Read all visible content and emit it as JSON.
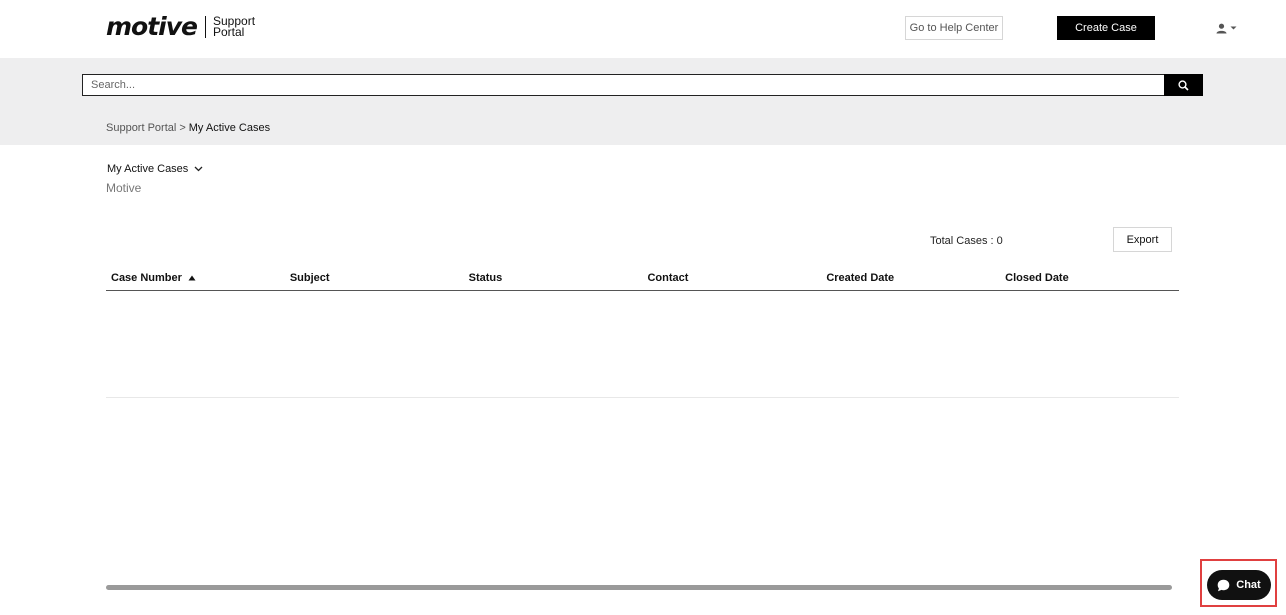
{
  "header": {
    "logo_text": "motive",
    "logo_sub_line1": "Support",
    "logo_sub_line2": "Portal",
    "help_center_label": "Go to Help Center",
    "create_case_label": "Create Case",
    "user_icon": "user-icon"
  },
  "search": {
    "placeholder": "Search...",
    "icon": "search-icon"
  },
  "breadcrumb": {
    "root": "Support Portal",
    "separator": ">",
    "current": "My Active Cases"
  },
  "list": {
    "title": "My Active Cases",
    "subtitle": "Motive",
    "total_label": "Total Cases : 0",
    "export_label": "Export"
  },
  "table": {
    "columns": [
      "Case Number",
      "Subject",
      "Status",
      "Contact",
      "Created Date",
      "Closed Date"
    ],
    "sorted_column": "Case Number",
    "sort_direction": "ascending",
    "rows": []
  },
  "chat": {
    "label": "Chat",
    "icon": "chat-bubble-icon"
  },
  "colors": {
    "primary_button": "#000000",
    "band_background": "#eeeeef",
    "highlight_border": "#e04040"
  }
}
